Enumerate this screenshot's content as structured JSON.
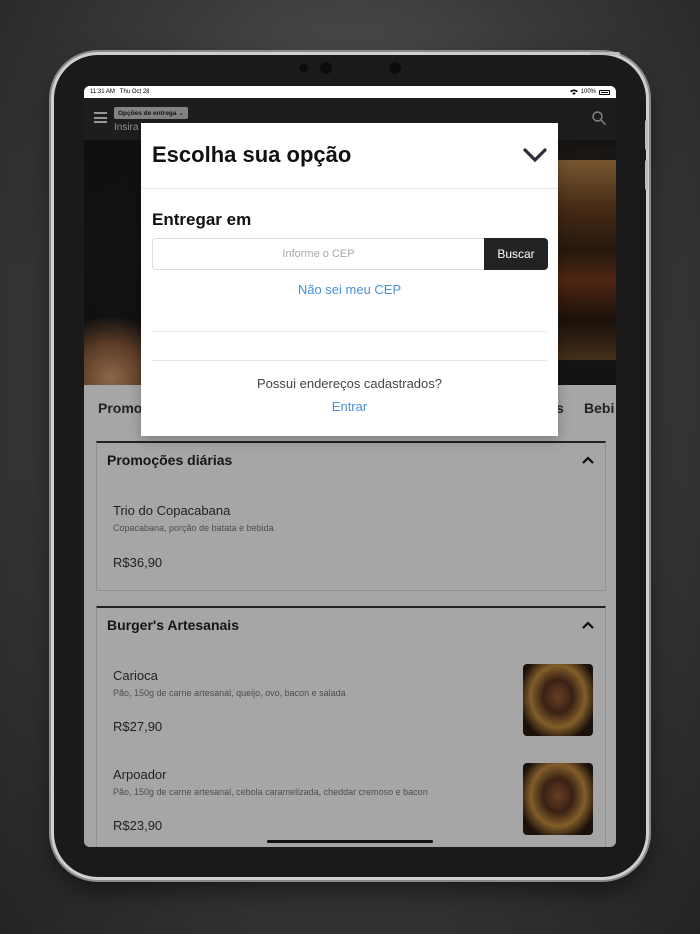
{
  "status_bar": {
    "time": "11:31 AM",
    "date": "Thu Oct 28",
    "battery": "100%"
  },
  "appbar": {
    "delivery_options": "Opções de entrega",
    "subtitle": "Insira"
  },
  "category_tabs": {
    "first": "Promo",
    "partial": "s",
    "last": "Bebi"
  },
  "sections": [
    {
      "title": "Promoções diárias",
      "items": [
        {
          "name": "Trio do Copacabana",
          "description": "Copacabana, porção de batata e bebida",
          "price": "R$36,90"
        }
      ]
    },
    {
      "title": "Burger's Artesanais",
      "items": [
        {
          "name": "Carioca",
          "description": "Pão, 150g de carne artesanal, queijo, ovo, bacon e salada",
          "price": "R$27,90"
        },
        {
          "name": "Arpoador",
          "description": "Pão, 150g de carne artesanal, cebola caramelizada, cheddar cremoso e bacon",
          "price": "R$23,90"
        }
      ]
    }
  ],
  "modal": {
    "title": "Escolha sua opção",
    "deliver_label": "Entregar em",
    "cep_placeholder": "Informe o CEP",
    "search_button": "Buscar",
    "unknown_cep_link": "Não sei meu CEP",
    "saved_question": "Possui endereços cadastrados?",
    "login_link": "Entrar"
  },
  "colors": {
    "accent_link": "#4a90d9",
    "appbar": "#2d2d2d",
    "button": "#222222"
  }
}
